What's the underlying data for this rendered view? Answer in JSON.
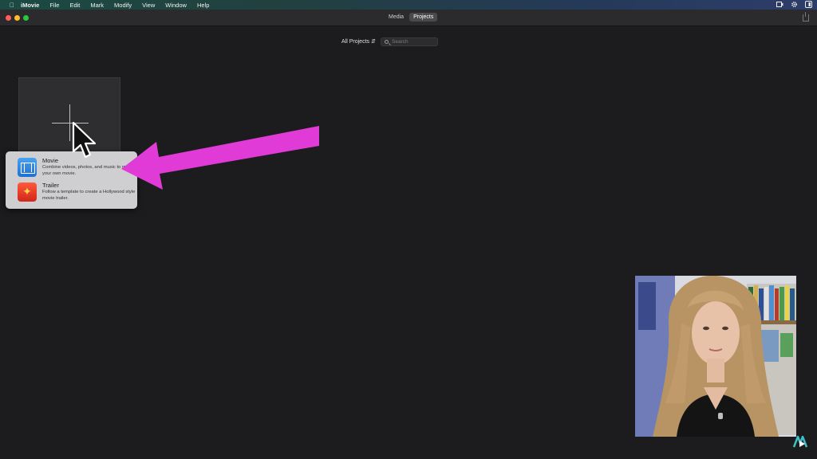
{
  "menubar": {
    "app_name": "iMovie",
    "items": [
      "File",
      "Edit",
      "Mark",
      "Modify",
      "View",
      "Window",
      "Help"
    ]
  },
  "titlebar": {
    "tabs": [
      {
        "label": "Media",
        "active": false
      },
      {
        "label": "Projects",
        "active": true
      }
    ]
  },
  "toolbar": {
    "filter_label": "All Projects",
    "search_placeholder": "Search"
  },
  "new_project_menu": {
    "movie": {
      "title": "Movie",
      "description": "Combine videos, photos, and music to make your own movie."
    },
    "trailer": {
      "title": "Trailer",
      "description": "Follow a template to create a Hollywood style movie trailer."
    }
  },
  "colors": {
    "annotation_arrow": "#e03bd6",
    "movie_icon": "#2f86e6",
    "trailer_icon": "#e8402a"
  }
}
